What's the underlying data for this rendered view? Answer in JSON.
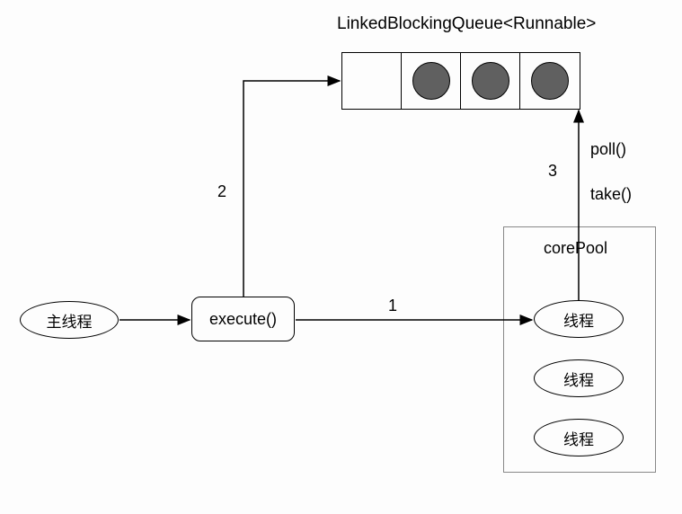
{
  "nodes": {
    "main_thread": "主线程",
    "execute": "execute()",
    "thread1": "线程",
    "thread2": "线程",
    "thread3": "线程"
  },
  "queue": {
    "title": "LinkedBlockingQueue<Runnable>",
    "cells": [
      false,
      true,
      true,
      true
    ]
  },
  "corepool": {
    "title": "corePool"
  },
  "edges": {
    "e1": "1",
    "e2": "2",
    "e3": "3"
  },
  "methods": {
    "poll": "poll()",
    "take": "take()"
  }
}
